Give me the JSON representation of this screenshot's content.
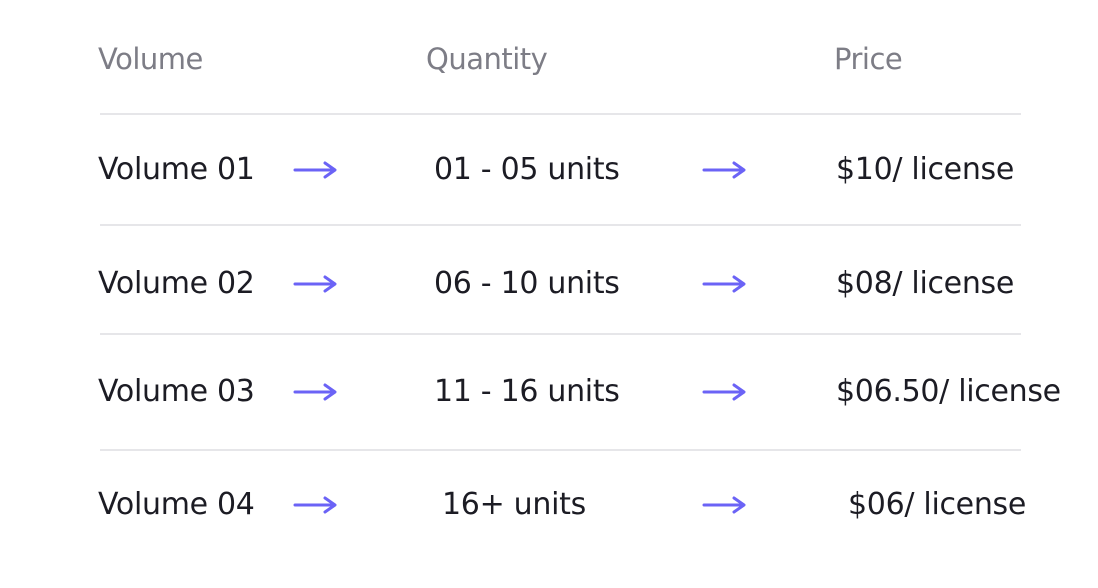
{
  "headers": {
    "volume": "Volume",
    "quantity": "Quantity",
    "price": "Price"
  },
  "rows": [
    {
      "volume": "Volume 01",
      "quantity": "01 - 05 units",
      "price": "$10/ license"
    },
    {
      "volume": "Volume 02",
      "quantity": "06 - 10 units",
      "price": "$08/ license"
    },
    {
      "volume": "Volume 03",
      "quantity": "11 - 16 units",
      "price": "$06.50/ license"
    },
    {
      "volume": "Volume 04",
      "quantity": "16+ units",
      "price": "$06/ license"
    }
  ],
  "colors": {
    "arrow": "#6b63f6",
    "header_text": "#7d7d86",
    "body_text": "#1c1c24",
    "divider": "#e6e6e9"
  },
  "icons": {
    "arrow": "arrow-right-icon"
  }
}
